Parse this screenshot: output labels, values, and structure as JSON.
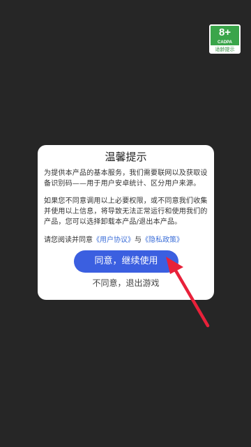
{
  "age_badge": {
    "rating": "8+",
    "org": "CADPA",
    "label": "适龄提示"
  },
  "dialog": {
    "title": "温馨提示",
    "paragraph1": "为提供本产品的基本服务，我们需要联网以及获取设备识别码——用于用户安卓统计、区分用户来源。",
    "paragraph2": "如果您不同意调用以上必要权限，或不同意我们收集并使用以上信息，将导致无法正常运行和使用我们的产品，您可以选择卸载本产品/退出本产品。",
    "agree_prefix": "请您阅读并同意",
    "user_agreement_link": "《用户协议》",
    "conjunction": "与",
    "privacy_policy_link": "《隐私政策》",
    "agree_button": "同意，继续使用",
    "disagree_button": "不同意，退出游戏"
  },
  "colors": {
    "background": "#262626",
    "primary_button": "#3b5fe0",
    "link": "#3d6fd8",
    "arrow": "#e8213a",
    "badge": "#3aa54a"
  },
  "icons": {
    "annotation": "red-arrow-icon"
  }
}
